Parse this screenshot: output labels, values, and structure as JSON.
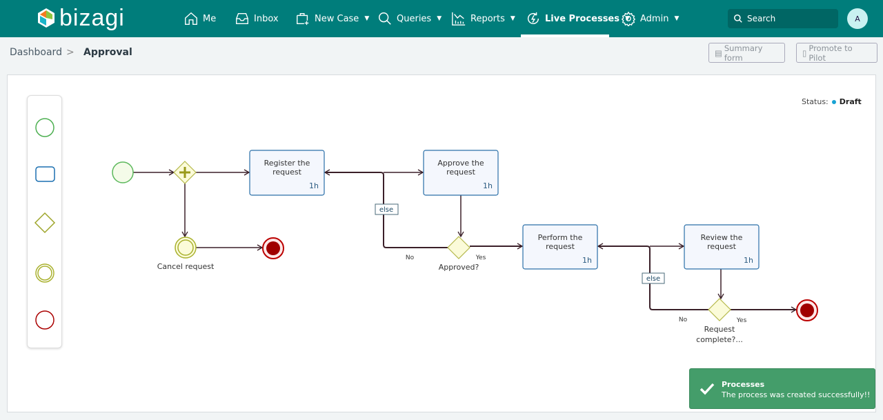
{
  "brand": {
    "name": "bizagi"
  },
  "nav": [
    {
      "label": "Me",
      "icon": "home-icon"
    },
    {
      "label": "Inbox",
      "icon": "inbox-icon"
    },
    {
      "label": "New Case",
      "icon": "new-case-icon",
      "dropdown": true
    },
    {
      "label": "Queries",
      "icon": "search-icon",
      "dropdown": true
    },
    {
      "label": "Reports",
      "icon": "chart-icon",
      "dropdown": true
    },
    {
      "label": "Live Processes",
      "icon": "live-process-icon",
      "dropdown": true,
      "active": true
    },
    {
      "label": "Admin",
      "icon": "gear-icon",
      "dropdown": true
    }
  ],
  "search": {
    "placeholder": "Search"
  },
  "user": {
    "initial": "A"
  },
  "breadcrumb": {
    "parent": "Dashboard",
    "current": "Approval"
  },
  "actions": {
    "summary": "Summary form",
    "promote": "Promote to Pilot"
  },
  "status": {
    "label": "Status:",
    "value": "Draft",
    "color": "#17a2d4"
  },
  "diagram": {
    "tasks": [
      {
        "name": "Register the",
        "name2": "request",
        "duration": "1h"
      },
      {
        "name": "Approve the",
        "name2": "request",
        "duration": "1h"
      },
      {
        "name": "Perform the",
        "name2": "request",
        "duration": "1h"
      },
      {
        "name": "Review the",
        "name2": "request",
        "duration": "1h"
      }
    ],
    "cancel_label": "Cancel request",
    "gateway1": {
      "label": "Approved?",
      "no": "No",
      "yes": "Yes",
      "else": "else"
    },
    "gateway2": {
      "label": "Request",
      "label2": "complete?...",
      "no": "No",
      "yes": "Yes",
      "else": "else"
    }
  },
  "toast": {
    "title": "Processes",
    "message": "The process was created successfully!!",
    "color": "#449d6a"
  }
}
